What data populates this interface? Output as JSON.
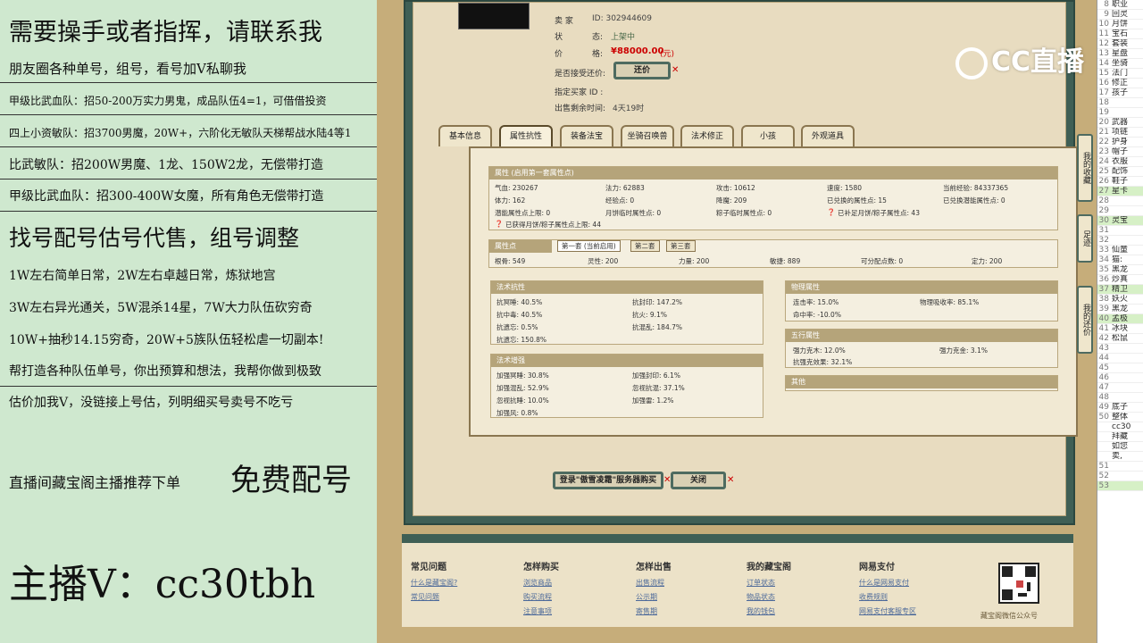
{
  "promo": {
    "lines": [
      "需要操手或者指挥，请联系我",
      "朋友圈各种单号，组号，看号加V私聊我",
      "甲级比武血队：招50-200万实力男鬼，成品队伍4=1，可借借投资",
      "四上小资敏队：招3700男魔，20W+，六阶化无敏队天梯帮战水陆4等1",
      "比武敏队：招200W男魔、1龙、150W2龙，无偿带打造",
      "甲级比武血队：招300-400W女魔，所有角色无偿带打造",
      "找号配号估号代售，组号调整",
      "1W左右简单日常，2W左右卓越日常，炼狱地宫",
      "3W左右异光通关，5W混杀14星，7W大力队伍砍穷奇",
      "10W+抽秒14.15穷奇，20W+5族队伍轻松虐一切副本!",
      "帮打造各种队伍单号，你出预算和想法，我帮你做到极致",
      "估价加我V，没链接上号估，列明细买号卖号不吃亏",
      "直播间藏宝阁主播推荐下单",
      "免费配号",
      "主播V：cc30tbh"
    ]
  },
  "info": {
    "seller_label": "卖 家",
    "seller_id": "ID:  302944609",
    "status_label": "状",
    "status_label2": "态:",
    "status_value": "上架中",
    "price_label": "价",
    "price_label2": "格:",
    "price_value": "¥88000.00",
    "price_unit": "(元)",
    "bargain_label": "是否接受还价:",
    "bargain_button": "还价",
    "buyer_label": "指定买家 ID :",
    "remain_label": "出售剩余时间:",
    "remain_value": "4天19时"
  },
  "tabs": [
    "基本信息",
    "属性抗性",
    "装备法宝",
    "坐骑召唤兽",
    "法术修正",
    "小孩",
    "外观道具"
  ],
  "attr": {
    "title": "属性 (启用第一套属性点)",
    "rows": [
      [
        "气血: 230267",
        "法力: 62883",
        "攻击: 10612",
        "速度: 1580",
        "当前经验: 84337365"
      ],
      [
        "体力: 162",
        "经验点: 0",
        "降魔: 209",
        "已兑换的属性点: 15",
        "已兑换潜能属性点: 0"
      ],
      [
        "潜能属性点上限: 0",
        "月饼临时属性点: 0",
        "粽子临时属性点: 0",
        "已补足月饼/粽子属性点: 43",
        ""
      ]
    ],
    "extra": "已获得月饼/粽子属性点上限: 44"
  },
  "points": {
    "title": "属性点",
    "sub": [
      "第一套 (当前启用)",
      "第二套",
      "第三套"
    ],
    "values": [
      "根骨: 549",
      "灵性: 200",
      "力量: 200",
      "敏捷: 889",
      "可分配点数: 0",
      "定力: 200"
    ]
  },
  "resist": {
    "title": "法术抗性",
    "items": [
      "抗冥睡: 40.5%",
      "抗封印: 147.2%",
      "抗中毒: 40.5%",
      "抗火: 9.1%",
      "抗遗忘: 0.5%",
      "抗混乱: 184.7%",
      "抗遗忘: 150.8%"
    ]
  },
  "enhance": {
    "title": "法术增强",
    "items": [
      "加强冥睡: 30.8%",
      "加强封印: 6.1%",
      "加强混乱: 52.9%",
      "忽视抗混: 37.1%",
      "忽视抗睡: 10.0%",
      "加强雷: 1.2%",
      "加强风: 0.8%"
    ]
  },
  "physical": {
    "title": "物理属性",
    "items": [
      "连击率: 15.0%",
      "物理吸收率: 85.1%",
      "命中率: -10.0%"
    ]
  },
  "elements": {
    "title": "五行属性",
    "items": [
      "强力克木: 12.0%",
      "强力克金: 3.1%",
      "抗强克效果: 32.1%"
    ]
  },
  "other": {
    "title": "其他"
  },
  "actions": {
    "buy": "登录\"傲雪凌霜\"服务器购买",
    "close": "关闭"
  },
  "side_buttons": [
    "我的收藏",
    "足迹",
    "我的还价"
  ],
  "help": {
    "cols": [
      {
        "title": "常见问题",
        "links": [
          "什么是藏宝阁?",
          "常见问题"
        ]
      },
      {
        "title": "怎样购买",
        "links": [
          "浏览商品",
          "购买流程",
          "注意事项"
        ]
      },
      {
        "title": "怎样出售",
        "links": [
          "出售流程",
          "公示期",
          "寄售期"
        ]
      },
      {
        "title": "我的藏宝阁",
        "links": [
          "订单状态",
          "物品状态",
          "我的钱包"
        ]
      },
      {
        "title": "网易支付",
        "links": [
          "什么是网易支付",
          "收费规则",
          "网易支付客服专区"
        ]
      }
    ],
    "qr_caption": "藏宝阁微信公众号"
  },
  "logo": "CC直播",
  "rstrip": {
    "rows": [
      [
        "8",
        "职业"
      ],
      [
        "9",
        "回灵"
      ],
      [
        "10",
        "月饼"
      ],
      [
        "11",
        "宝石"
      ],
      [
        "12",
        "套装"
      ],
      [
        "13",
        "星盘"
      ],
      [
        "14",
        "坐骑"
      ],
      [
        "15",
        "法门"
      ],
      [
        "16",
        "修正"
      ],
      [
        "17",
        "孩子"
      ],
      [
        "18",
        ""
      ],
      [
        "19",
        ""
      ],
      [
        "20",
        "武器"
      ],
      [
        "21",
        "项链"
      ],
      [
        "22",
        "护身"
      ],
      [
        "23",
        "帽子"
      ],
      [
        "24",
        "衣服"
      ],
      [
        "25",
        "配饰"
      ],
      [
        "26",
        "鞋子"
      ],
      [
        "27",
        "星卡"
      ],
      [
        "28",
        ""
      ],
      [
        "29",
        ""
      ],
      [
        "30",
        "灵宝"
      ],
      [
        "31",
        ""
      ],
      [
        "32",
        ""
      ],
      [
        "33",
        "仙童"
      ],
      [
        "34",
        "猫:"
      ],
      [
        "35",
        "黑龙"
      ],
      [
        "36",
        "炒真"
      ],
      [
        "37",
        "精卫"
      ],
      [
        "38",
        "妖火"
      ],
      [
        "39",
        "黑龙"
      ],
      [
        "40",
        "孟极"
      ],
      [
        "41",
        "冰块"
      ],
      [
        "42",
        "松鼠"
      ],
      [
        "43",
        ""
      ],
      [
        "44",
        ""
      ],
      [
        "45",
        ""
      ],
      [
        "46",
        ""
      ],
      [
        "47",
        ""
      ],
      [
        "48",
        ""
      ],
      [
        "49",
        "底子"
      ],
      [
        "50",
        "整体"
      ],
      [
        "",
        "cc30"
      ],
      [
        "",
        "拜藏"
      ],
      [
        "",
        "如您"
      ],
      [
        "",
        "卖,"
      ],
      [
        "51",
        ""
      ],
      [
        "52",
        ""
      ],
      [
        "53",
        ""
      ]
    ],
    "highlight": [
      19,
      22,
      29,
      32,
      49
    ]
  }
}
